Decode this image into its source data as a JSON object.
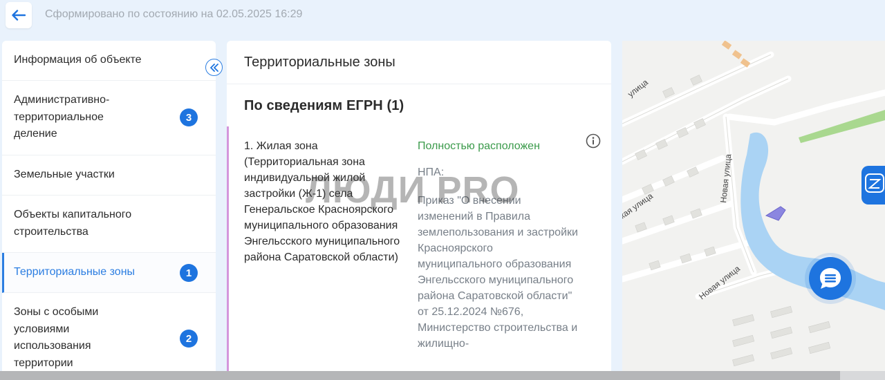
{
  "header": {
    "timestamp": "Сформировано по состоянию на 02.05.2025 16:29"
  },
  "sidebar": {
    "items": [
      {
        "label": "Информация об объекте",
        "badge": null,
        "active": false
      },
      {
        "label": "Административно-территориальное деление",
        "badge": "3",
        "active": false
      },
      {
        "label": "Земельные участки",
        "badge": null,
        "active": false
      },
      {
        "label": "Объекты капитального строительства",
        "badge": null,
        "active": false
      },
      {
        "label": "Территориальные зоны",
        "badge": "1",
        "active": true
      },
      {
        "label": "Зоны с особыми условиями использования территории",
        "badge": "2",
        "active": false
      }
    ]
  },
  "main": {
    "title": "Территориальные зоны",
    "section_title": "По сведениям ЕГРН (1)",
    "zone": {
      "name": "1. Жилая зона (Территориальная зона индивидуальной жилой застройки (Ж-1) села Генеральское Красноярского муниципального образования Энгельсского муниципального района Саратовской области)",
      "status": "Полностью расположен",
      "npa_label": "НПА:",
      "npa_text": "Приказ \"О внесении изменений в Правила землепользования и застройки Красноярского муниципального образования Энгельсского муниципального района Саратовской области\" от 25.12.2024 №676, Министерство строительства и жилищно-"
    }
  },
  "watermark": "ЛЮДИ PRO",
  "map": {
    "street_labels": [
      "улица",
      "Новая улица",
      "кая улица",
      "Новая улица"
    ],
    "water_color": "#aad3f4",
    "highlight_color": "#8b86e0"
  },
  "colors": {
    "accent": "#1e74df",
    "status_green": "#3a9a4a",
    "zone_bar": "#d596dc"
  },
  "icons": {
    "back": "arrow-left-icon",
    "collapse": "double-chevron-left-icon",
    "info": "info-circle-icon",
    "chat": "chat-bubble-icon"
  }
}
